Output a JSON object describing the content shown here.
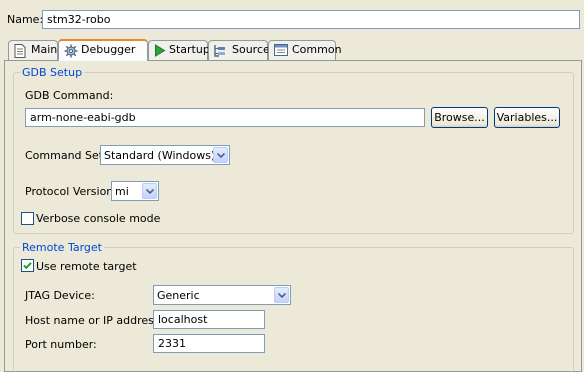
{
  "name_field": {
    "label": "Name:",
    "value": "stm32-robo"
  },
  "tabs": [
    {
      "label": "Main",
      "icon": "document-icon"
    },
    {
      "label": "Debugger",
      "icon": "bug-gear-icon",
      "active": true
    },
    {
      "label": "Startup",
      "icon": "play-icon"
    },
    {
      "label": "Source",
      "icon": "source-lookup-icon"
    },
    {
      "label": "Common",
      "icon": "common-icon"
    }
  ],
  "gdb_setup": {
    "title": "GDB Setup",
    "command_label": "GDB Command:",
    "command_value": "arm-none-eabi-gdb",
    "browse_label": "Browse...",
    "variables_label": "Variables...",
    "command_set_label": "Command Set:",
    "command_set_value": "Standard (Windows)",
    "protocol_label": "Protocol Version:",
    "protocol_value": "mi",
    "verbose_label": "Verbose console mode",
    "verbose_checked": false
  },
  "remote_target": {
    "title": "Remote Target",
    "use_remote_label": "Use remote target",
    "use_remote_checked": true,
    "jtag_label": "JTAG Device:",
    "jtag_value": "Generic",
    "host_label": "Host name or IP address:",
    "host_value": "localhost",
    "port_label": "Port number:",
    "port_value": "2331"
  },
  "colors": {
    "window_bg": "#ece9d8",
    "group_title": "#0046d5",
    "active_tab_accent": "#e68b2c",
    "checkmark": "#21a121"
  }
}
